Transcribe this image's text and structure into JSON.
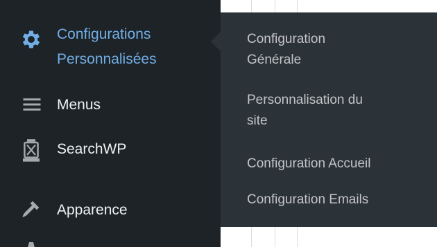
{
  "sidebar": {
    "items": [
      {
        "label_line1": "Configurations",
        "label_line2": "Personnalisées",
        "icon": "gear-icon"
      },
      {
        "label": "Menus",
        "icon": "menu-lines-icon"
      },
      {
        "label": "SearchWP",
        "icon": "lantern-icon"
      },
      {
        "label": "Apparence",
        "icon": "brush-icon"
      }
    ]
  },
  "submenu": {
    "items": [
      {
        "line1": "Configuration",
        "line2": "Générale"
      },
      {
        "line1": "Personnalisation du",
        "line2": "site"
      },
      {
        "line1": "Configuration Accueil"
      },
      {
        "line1": "Configuration Emails"
      }
    ]
  },
  "colors": {
    "sidebar_bg": "#1d2327",
    "submenu_bg": "#2c3338",
    "accent": "#72aee6",
    "text": "#f0f0f1",
    "submenu_text": "#c3c4c7"
  }
}
